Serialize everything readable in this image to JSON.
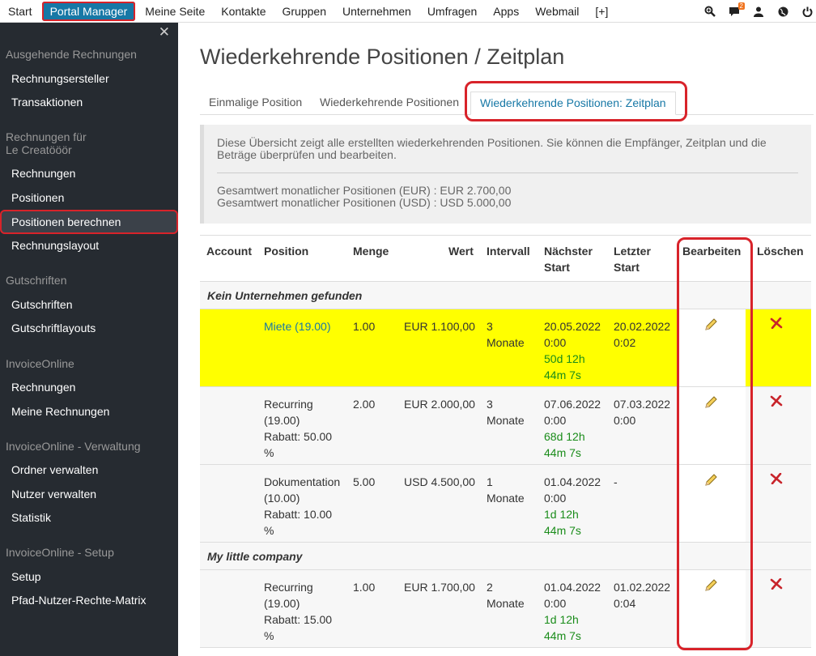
{
  "topnav": {
    "items": [
      "Start",
      "Portal Manager",
      "Meine Seite",
      "Kontakte",
      "Gruppen",
      "Unternehmen",
      "Umfragen",
      "Apps",
      "Webmail",
      "[+]"
    ],
    "active_index": 1,
    "message_badge": "2"
  },
  "sidebar": {
    "sections": [
      {
        "title": "Ausgehende Rechnungen",
        "items": [
          "Rechnungsersteller",
          "Transaktionen"
        ]
      },
      {
        "title": "Rechnungen für",
        "title2": "Le Creatööör",
        "items": [
          "Rechnungen",
          "Positionen",
          "Positionen berechnen",
          "Rechnungslayout"
        ]
      },
      {
        "title": "Gutschriften",
        "items": [
          "Gutschriften",
          "Gutschriftlayouts"
        ]
      },
      {
        "title": "InvoiceOnline",
        "items": [
          "Rechnungen",
          "Meine Rechnungen"
        ]
      },
      {
        "title": "InvoiceOnline - Verwaltung",
        "items": [
          "Ordner verwalten",
          "Nutzer verwalten",
          "Statistik"
        ]
      },
      {
        "title": "InvoiceOnline - Setup",
        "items": [
          "Setup",
          "Pfad-Nutzer-Rechte-Matrix"
        ]
      }
    ],
    "active_item": "Positionen berechnen"
  },
  "page": {
    "title": "Wiederkehrende Positionen / Zeitplan",
    "tabs": [
      "Einmalige Position",
      "Wiederkehrende Positionen",
      "Wiederkehrende Positionen: Zeitplan"
    ],
    "active_tab": 2
  },
  "info": {
    "description": "Diese Übersicht zeigt alle erstellten wiederkehrenden Positionen. Sie können die Empfänger, Zeitplan und die Beträge überprüfen und bearbeiten.",
    "total_eur": "Gesamtwert monatlicher Positionen (EUR) : EUR 2.700,00",
    "total_usd": "Gesamtwert monatlicher Positionen (USD) : USD 5.000,00"
  },
  "table": {
    "headers": {
      "account": "Account",
      "position": "Position",
      "menge": "Menge",
      "wert": "Wert",
      "intervall": "Intervall",
      "naechster_1": "Nächster",
      "naechster_2": "Start",
      "letzter_1": "Letzter",
      "letzter_2": "Start",
      "bearbeiten": "Bearbeiten",
      "loeschen": "Löschen"
    },
    "groups": [
      {
        "name": "Kein Unternehmen gefunden",
        "rows": [
          {
            "position": [
              "Miete (19.00)"
            ],
            "menge": "1.00",
            "wert": "EUR 1.100,00",
            "intervall": [
              "3",
              "Monate"
            ],
            "next": [
              "20.05.2022",
              "0:00"
            ],
            "countdown": [
              "50d 12h",
              "44m 7s"
            ],
            "last": [
              "20.02.2022",
              "0:02"
            ],
            "highlight": true
          },
          {
            "position": [
              "Recurring",
              "(19.00)",
              "Rabatt: 50.00",
              "%"
            ],
            "menge": "2.00",
            "wert": "EUR 2.000,00",
            "intervall": [
              "3",
              "Monate"
            ],
            "next": [
              "07.06.2022",
              "0:00"
            ],
            "countdown": [
              "68d 12h",
              "44m 7s"
            ],
            "last": [
              "07.03.2022",
              "0:00"
            ],
            "highlight": false
          },
          {
            "position": [
              "Dokumentation",
              "(10.00)",
              "Rabatt: 10.00",
              "%"
            ],
            "menge": "5.00",
            "wert": "USD 4.500,00",
            "intervall": [
              "1",
              "Monate"
            ],
            "next": [
              "01.04.2022",
              "0:00"
            ],
            "countdown": [
              "1d 12h",
              "44m 7s"
            ],
            "last": [
              "-",
              ""
            ],
            "highlight": false
          }
        ]
      },
      {
        "name": "My little company",
        "rows": [
          {
            "position": [
              "Recurring",
              "(19.00)",
              "Rabatt: 15.00",
              "%"
            ],
            "menge": "1.00",
            "wert": "EUR 1.700,00",
            "intervall": [
              "2",
              "Monate"
            ],
            "next": [
              "01.04.2022",
              "0:00"
            ],
            "countdown": [
              "1d 12h",
              "44m 7s"
            ],
            "last": [
              "01.02.2022",
              "0:04"
            ],
            "highlight": false
          }
        ]
      }
    ]
  },
  "icons": {
    "search": "zoom-search-icon",
    "messages": "chat-bubble-icon",
    "user": "user-icon",
    "globe": "globe-icon",
    "power": "power-icon",
    "edit": "pencil-icon",
    "delete": "red-x-icon"
  }
}
